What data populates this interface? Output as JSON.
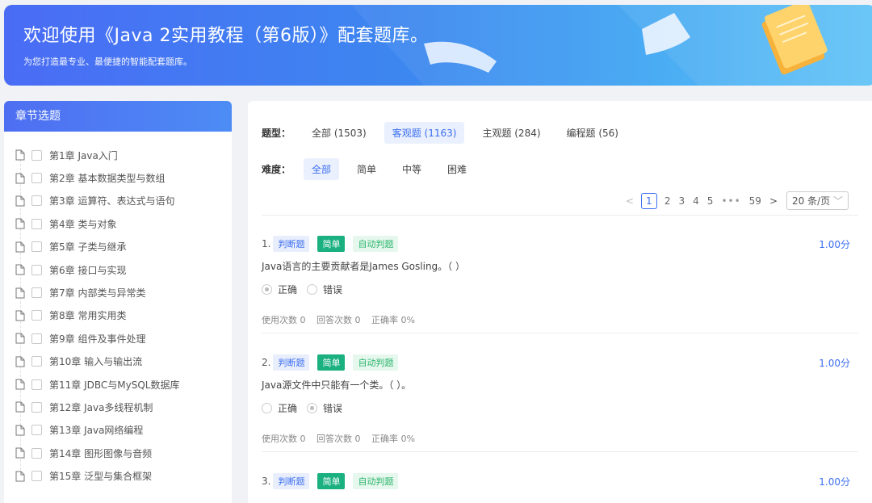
{
  "banner": {
    "title": "欢迎使用《Java 2实用教程（第6版）》配套题库。",
    "subtitle": "为您打造最专业、最便捷的智能配套题库。"
  },
  "sidebar": {
    "header": "章节选题",
    "chapters": [
      "第1章 Java入门",
      "第2章 基本数据类型与数组",
      "第3章 运算符、表达式与语句",
      "第4章 类与对象",
      "第5章 子类与继承",
      "第6章 接口与实现",
      "第7章 内部类与异常类",
      "第8章 常用实用类",
      "第9章 组件及事件处理",
      "第10章 输入与输出流",
      "第11章 JDBC与MySQL数据库",
      "第12章 Java多线程机制",
      "第13章 Java网络编程",
      "第14章 图形图像与音频",
      "第15章 泛型与集合框架"
    ]
  },
  "filters": {
    "type_label": "题型：",
    "types": [
      "全部 (1503)",
      "客观题 (1163)",
      "主观题 (284)",
      "编程题 (56)"
    ],
    "type_selected": 1,
    "difficulty_label": "难度：",
    "difficulties": [
      "全部",
      "简单",
      "中等",
      "困难"
    ],
    "difficulty_selected": 0
  },
  "pagination": {
    "current": "1",
    "pages": [
      "2",
      "3",
      "4",
      "5"
    ],
    "ellipsis": "•••",
    "last": "59",
    "prev": "<",
    "next": ">",
    "page_size": "20 条/页"
  },
  "questions": [
    {
      "num": "1.",
      "tag_type": "判断题",
      "tag_level": "简单",
      "tag_grade": "自动判题",
      "score": "1.00分",
      "stem": "Java语言的主要贡献者是James Gosling。（   ）",
      "options": [
        "正确",
        "错误"
      ],
      "selected": 0,
      "stats": [
        "使用次数 0",
        "回答次数 0",
        "正确率 0%"
      ]
    },
    {
      "num": "2.",
      "tag_type": "判断题",
      "tag_level": "简单",
      "tag_grade": "自动判题",
      "score": "1.00分",
      "stem": "Java源文件中只能有一个类。（   ）。",
      "options": [
        "正确",
        "错误"
      ],
      "selected": 1,
      "stats": [
        "使用次数 0",
        "回答次数 0",
        "正确率 0%"
      ]
    },
    {
      "num": "3.",
      "tag_type": "判断题",
      "tag_level": "简单",
      "tag_grade": "自动判题",
      "score": "1.00分"
    }
  ],
  "colors": {
    "accent": "#3b6ef0",
    "level_green": "#1bb07f",
    "auto_green": "#2bb56b"
  }
}
